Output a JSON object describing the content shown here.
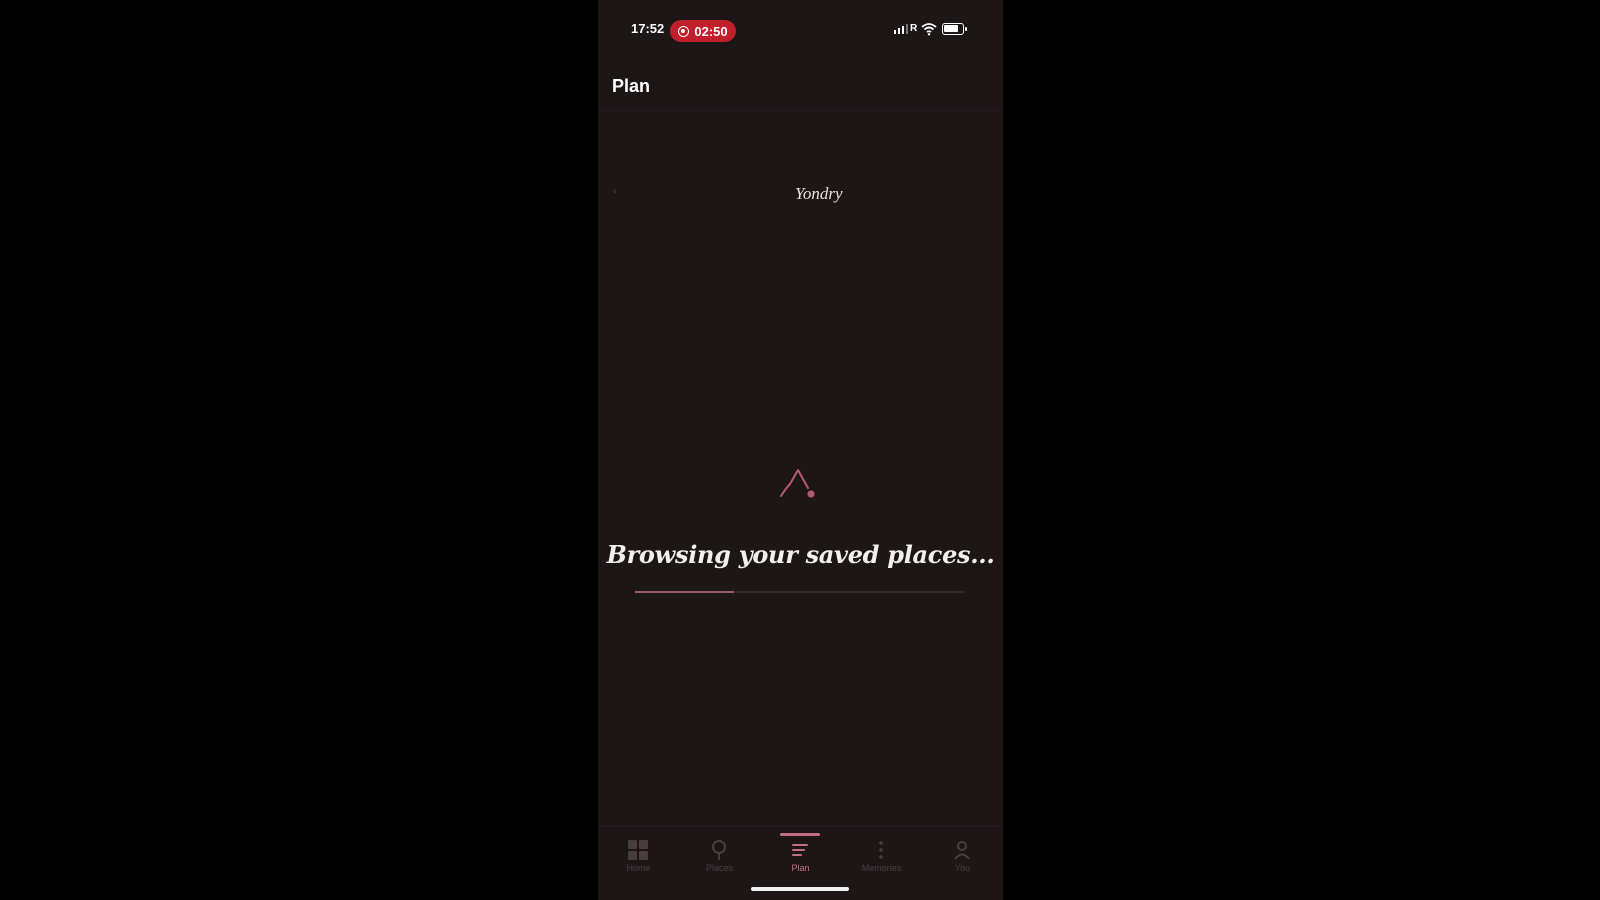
{
  "status_bar": {
    "time": "17:52",
    "recording_timer": "02:50",
    "carrier": "R"
  },
  "header": {
    "title": "Plan"
  },
  "brand": {
    "name": "Yondry"
  },
  "loading": {
    "message": "Browsing your saved places...",
    "progress_percent": 30
  },
  "tabs": [
    {
      "label": "Home",
      "icon": "grid-icon",
      "active": false
    },
    {
      "label": "Places",
      "icon": "pin-icon",
      "active": false
    },
    {
      "label": "Plan",
      "icon": "list-icon",
      "active": true
    },
    {
      "label": "Memories",
      "icon": "dots-icon",
      "active": false
    },
    {
      "label": "You",
      "icon": "person-icon",
      "active": false
    }
  ],
  "colors": {
    "background": "#1d1617",
    "accent": "#c56f85",
    "record": "#c01f2b"
  }
}
